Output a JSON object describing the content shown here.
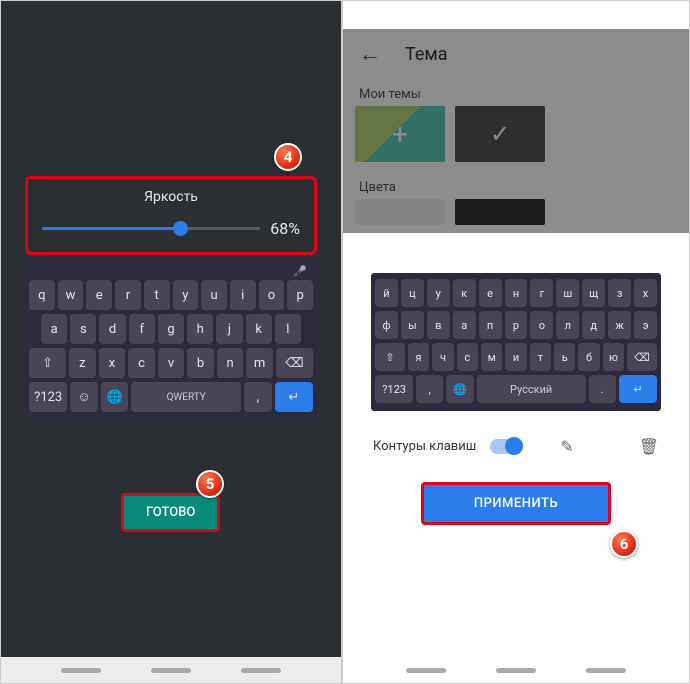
{
  "left": {
    "brightness": {
      "label": "Яркость",
      "value_text": "68%",
      "value": 68
    },
    "keyboard": {
      "row1": [
        "q",
        "w",
        "e",
        "r",
        "t",
        "y",
        "u",
        "i",
        "o",
        "p"
      ],
      "row2": [
        "a",
        "s",
        "d",
        "f",
        "g",
        "h",
        "j",
        "k",
        "l"
      ],
      "row3": [
        "⇧",
        "z",
        "x",
        "c",
        "v",
        "b",
        "n",
        "m",
        "⌫"
      ],
      "row4": {
        "nums": "?123",
        "emoji": "☺",
        "globe": "🌐",
        "space": "QWERTY",
        "comma": ",",
        "enter": "↵"
      }
    },
    "done": "ГОТОВО"
  },
  "right": {
    "title": "Тема",
    "my_themes": "Мои темы",
    "colors": "Цвета",
    "keyboard": {
      "row1": [
        "й",
        "ц",
        "у",
        "к",
        "е",
        "н",
        "г",
        "ш",
        "щ",
        "з",
        "х"
      ],
      "row2": [
        "ф",
        "ы",
        "в",
        "а",
        "п",
        "р",
        "о",
        "л",
        "д",
        "ж",
        "э"
      ],
      "row3": [
        "⇧",
        "я",
        "ч",
        "с",
        "м",
        "и",
        "т",
        "ь",
        "б",
        "ю",
        "⌫"
      ],
      "row4": {
        "nums": "?123",
        "comma": ",",
        "globe": "🌐",
        "space": "Русский",
        "dot": ".",
        "enter": "↵"
      }
    },
    "outlines": "Контуры клавиш",
    "apply": "ПРИМЕНИТЬ"
  },
  "badges": {
    "b4": "4",
    "b5": "5",
    "b6": "6"
  }
}
